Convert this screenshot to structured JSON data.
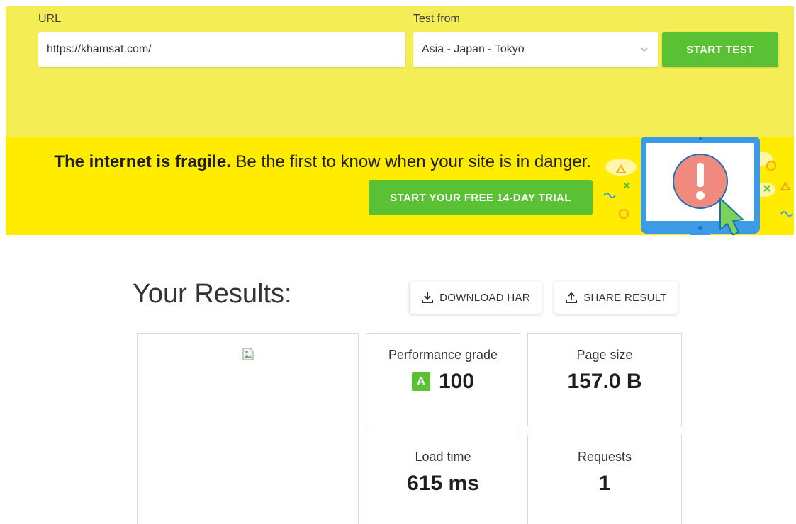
{
  "form": {
    "url_label": "URL",
    "url_value": "https://khamsat.com/",
    "test_from_label": "Test from",
    "test_from_value": "Asia - Japan - Tokyo",
    "start_button": "START TEST"
  },
  "banner": {
    "headline_bold": "The internet is fragile.",
    "headline_rest": " Be the first to know when your site is in danger.",
    "trial_button": "START YOUR FREE 14-DAY TRIAL"
  },
  "results": {
    "title": "Your Results:",
    "download_har": "DOWNLOAD HAR",
    "share_result": "SHARE RESULT",
    "metrics": {
      "performance": {
        "label": "Performance grade",
        "grade": "A",
        "value": "100"
      },
      "page_size": {
        "label": "Page size",
        "value": "157.0 B"
      },
      "load_time": {
        "label": "Load time",
        "value": "615 ms"
      },
      "requests": {
        "label": "Requests",
        "value": "1"
      }
    }
  },
  "colors": {
    "form_bg": "#f5ed55",
    "banner_bg": "#ffec00",
    "accent_green": "#5ac134",
    "monitor_blue": "#3b9be6",
    "alert_red": "#f08a7e"
  }
}
